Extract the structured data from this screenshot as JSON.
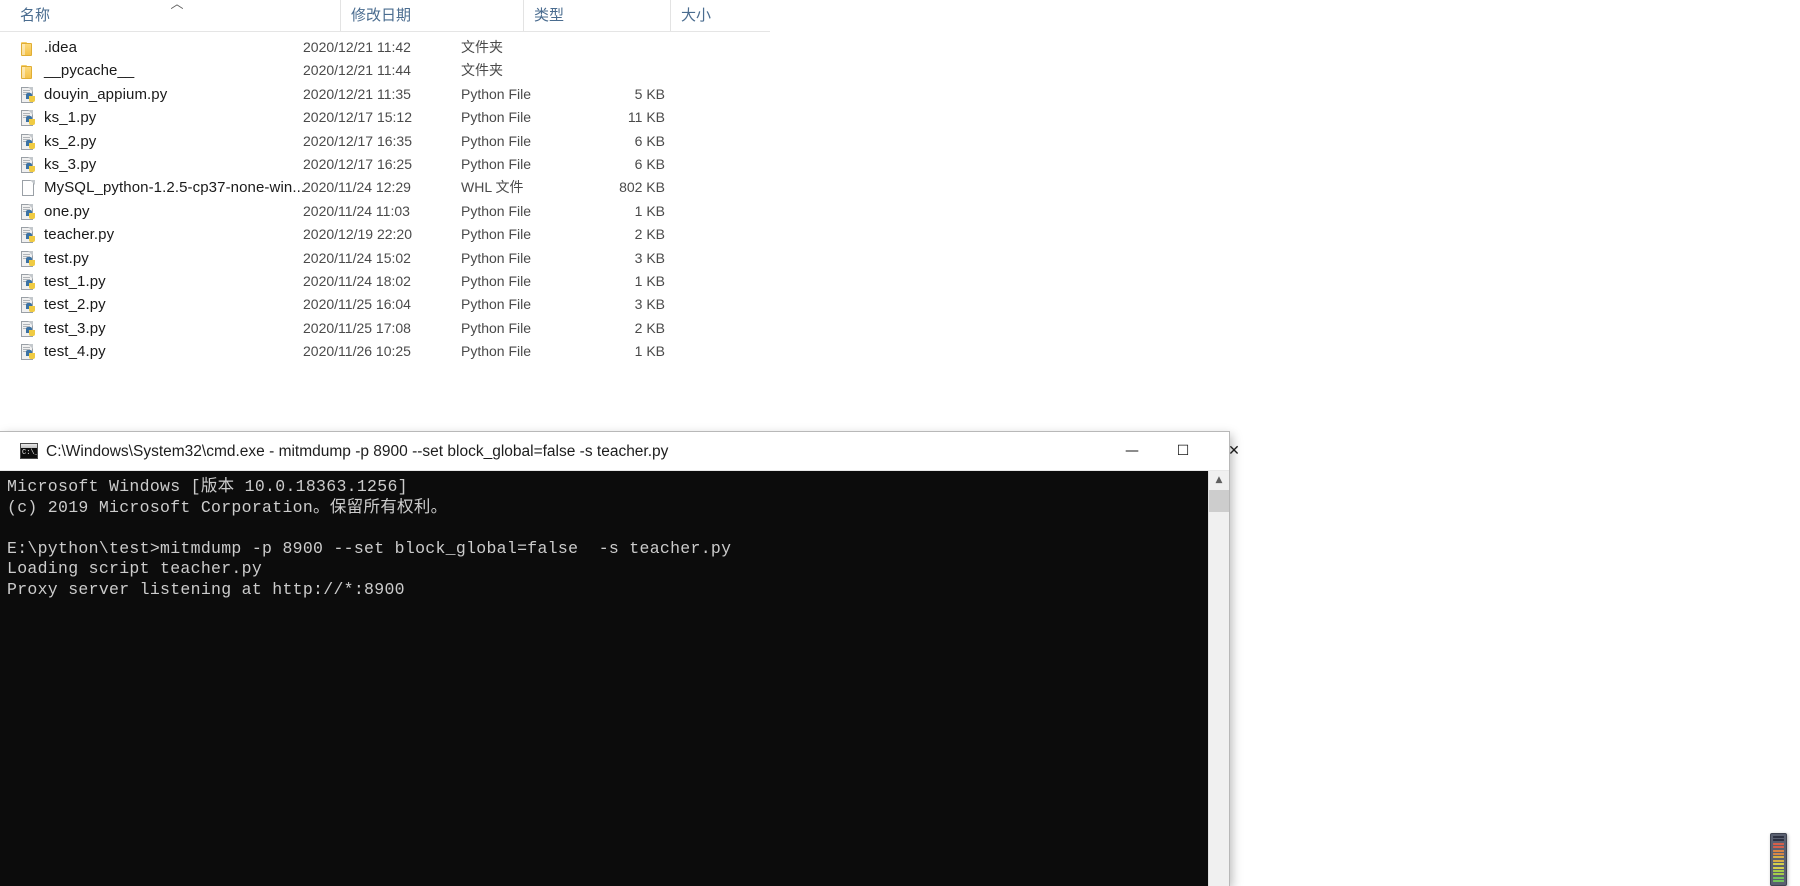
{
  "explorer": {
    "columns": [
      {
        "key": "name",
        "label": "名称",
        "sorted": true,
        "sort_dir": "asc"
      },
      {
        "key": "date",
        "label": "修改日期",
        "sorted": false
      },
      {
        "key": "type",
        "label": "类型",
        "sorted": false
      },
      {
        "key": "size",
        "label": "大小",
        "sorted": false
      }
    ],
    "sort_indicator_glyph": "︿",
    "files": [
      {
        "icon": "folder-icon",
        "name": ".idea",
        "date": "2020/12/21 11:42",
        "type": "文件夹",
        "size": ""
      },
      {
        "icon": "folder-icon",
        "name": "__pycache__",
        "date": "2020/12/21 11:44",
        "type": "文件夹",
        "size": ""
      },
      {
        "icon": "python-file-icon",
        "name": "douyin_appium.py",
        "date": "2020/12/21 11:35",
        "type": "Python File",
        "size": "5 KB"
      },
      {
        "icon": "python-file-icon",
        "name": "ks_1.py",
        "date": "2020/12/17 15:12",
        "type": "Python File",
        "size": "11 KB"
      },
      {
        "icon": "python-file-icon",
        "name": "ks_2.py",
        "date": "2020/12/17 16:35",
        "type": "Python File",
        "size": "6 KB"
      },
      {
        "icon": "python-file-icon",
        "name": "ks_3.py",
        "date": "2020/12/17 16:25",
        "type": "Python File",
        "size": "6 KB"
      },
      {
        "icon": "document-icon",
        "name": "MySQL_python-1.2.5-cp37-none-win...",
        "date": "2020/11/24 12:29",
        "type": "WHL 文件",
        "size": "802 KB"
      },
      {
        "icon": "python-file-icon",
        "name": "one.py",
        "date": "2020/11/24 11:03",
        "type": "Python File",
        "size": "1 KB"
      },
      {
        "icon": "python-file-icon",
        "name": "teacher.py",
        "date": "2020/12/19 22:20",
        "type": "Python File",
        "size": "2 KB"
      },
      {
        "icon": "python-file-icon",
        "name": "test.py",
        "date": "2020/11/24 15:02",
        "type": "Python File",
        "size": "3 KB"
      },
      {
        "icon": "python-file-icon",
        "name": "test_1.py",
        "date": "2020/11/24 18:02",
        "type": "Python File",
        "size": "1 KB"
      },
      {
        "icon": "python-file-icon",
        "name": "test_2.py",
        "date": "2020/11/25 16:04",
        "type": "Python File",
        "size": "3 KB"
      },
      {
        "icon": "python-file-icon",
        "name": "test_3.py",
        "date": "2020/11/25 17:08",
        "type": "Python File",
        "size": "2 KB"
      },
      {
        "icon": "python-file-icon",
        "name": "test_4.py",
        "date": "2020/11/26 10:25",
        "type": "Python File",
        "size": "1 KB"
      }
    ]
  },
  "cmd_window": {
    "app_icon": "cmd-console-icon",
    "icon_prompt_text": "C:\\_",
    "title": "C:\\Windows\\System32\\cmd.exe - mitmdump  -p 8900 --set block_global=false  -s teacher.py",
    "controls": {
      "minimize_glyph": "—",
      "maximize_glyph": "☐",
      "close_glyph": "✕"
    },
    "console_text": "Microsoft Windows [版本 10.0.18363.1256]\n(c) 2019 Microsoft Corporation。保留所有权利。\n\nE:\\python\\test>mitmdump -p 8900 --set block_global=false  -s teacher.py\nLoading script teacher.py\nProxy server listening at http://*:8900",
    "console_lines": [
      "Microsoft Windows [版本 10.0.18363.1256]",
      "(c) 2019 Microsoft Corporation。保留所有权利。",
      "",
      "E:\\python\\test>mitmdump -p 8900 --set block_global=false  -s teacher.py",
      "Loading script teacher.py",
      "Proxy server listening at http://*:8900"
    ],
    "scrollbar": {
      "up_arrow_glyph": "▲"
    },
    "colors": {
      "background": "#0c0c0c",
      "foreground": "#cccccc",
      "titlebar": "#ffffff"
    }
  },
  "led_meter": {
    "name": "signal-level-meter",
    "segment_colors": [
      "#2c3040",
      "#2c3040",
      "#d4604a",
      "#d4604a",
      "#d98646",
      "#d98646",
      "#d9b046",
      "#d9b046",
      "#d4d04c",
      "#d4d04c",
      "#a8cc4a",
      "#a8cc4a",
      "#74c45a",
      "#74c45a"
    ]
  }
}
